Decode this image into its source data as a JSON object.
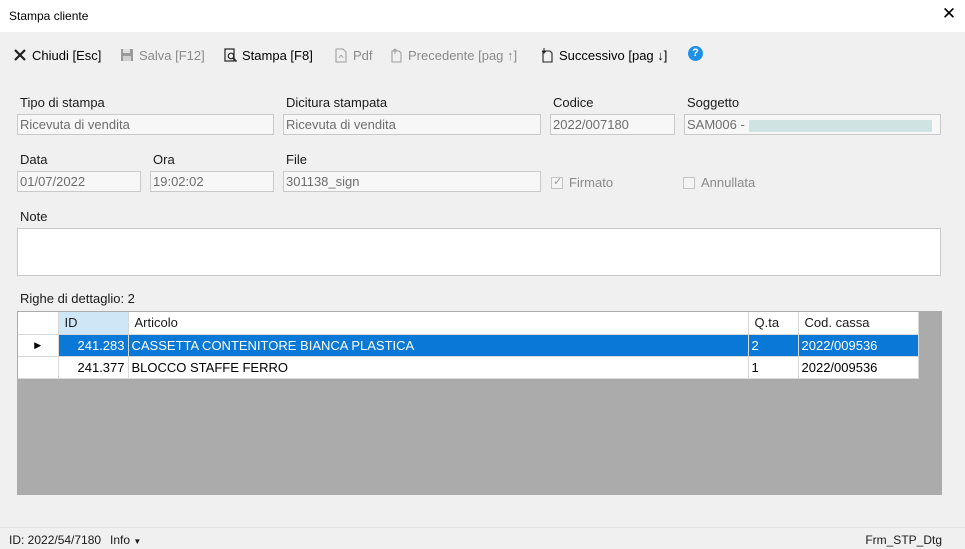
{
  "window": {
    "title": "Stampa cliente"
  },
  "toolbar": {
    "chiudi": "Chiudi [Esc]",
    "salva": "Salva [F12]",
    "stampa": "Stampa [F8]",
    "pdf": "Pdf",
    "precedente": "Precedente [pag ↑]",
    "successivo": "Successivo [pag ↓]",
    "help": "?"
  },
  "form": {
    "tipo_label": "Tipo di stampa",
    "tipo_value": "Ricevuta di vendita",
    "dicitura_label": "Dicitura stampata",
    "dicitura_value": "Ricevuta di vendita",
    "codice_label": "Codice",
    "codice_value": "2022/007180",
    "soggetto_label": "Soggetto",
    "soggetto_value": "SAM006 - ",
    "data_label": "Data",
    "data_value": "01/07/2022",
    "ora_label": "Ora",
    "ora_value": "19:02:02",
    "file_label": "File",
    "file_value": "301138_sign",
    "firmato_label": "Firmato",
    "firmato_checked": true,
    "annullata_label": "Annullata",
    "annullata_checked": false,
    "note_label": "Note",
    "note_value": ""
  },
  "grid": {
    "count_label": "Righe di dettaglio: 2",
    "columns": [
      "ID",
      "Articolo",
      "Q.ta",
      "Cod. cassa"
    ],
    "rows": [
      {
        "id": "241.283",
        "articolo": "CASSETTA CONTENITORE BIANCA PLASTICA",
        "qta": "2",
        "cassa": "2022/009536",
        "selected": true
      },
      {
        "id": "241.377",
        "articolo": "BLOCCO STAFFE FERRO",
        "qta": "1",
        "cassa": "2022/009536",
        "selected": false
      }
    ]
  },
  "status": {
    "id_text": "ID: 2022/54/7180",
    "info": "Info",
    "form_name": "Frm_STP_Dtg"
  },
  "colors": {
    "selection": "#0a78d7",
    "help": "#1e90e6",
    "grid_bg": "#ababab"
  }
}
